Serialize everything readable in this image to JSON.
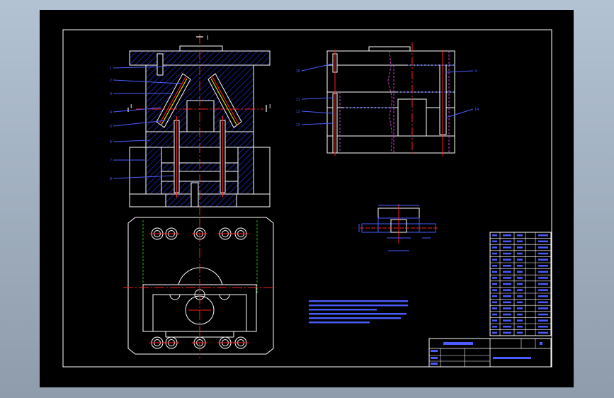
{
  "viewer": {
    "background_top": "#b3c2d3",
    "background_bottom": "#8e9cab",
    "canvas_color": "#000000"
  },
  "drawing": {
    "section_marks": {
      "top": "I",
      "left": "I",
      "right": "I"
    },
    "colors": {
      "outline": "#ffffff",
      "hatch": "#2a3cff",
      "centerline": "#ff2020",
      "hidden_green": "#1fb81f",
      "leader": "#4a5cff",
      "part_magenta": "#d43cd4",
      "part_yellow": "#d9d900",
      "border": "#ffffff"
    },
    "section_view_callouts": [
      "1",
      "2",
      "3",
      "4",
      "5",
      "6",
      "7",
      "8"
    ],
    "side_view_callouts": [
      "10",
      "11",
      "12",
      "9",
      "13",
      "14"
    ]
  }
}
